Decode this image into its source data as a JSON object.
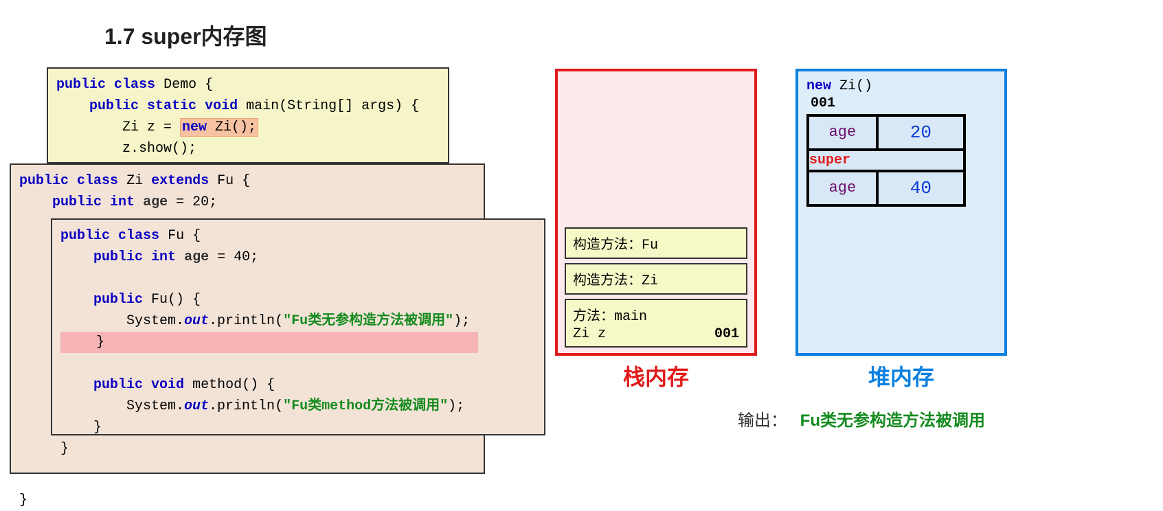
{
  "title": "1.7 super内存图",
  "code": {
    "demo": {
      "l1_kw1": "public",
      "l1_kw2": "class",
      "l1_name": "Demo {",
      "l2_kw1": "public",
      "l2_kw2": "static",
      "l2_kw3": "void",
      "l2_rest": "main(String[] args) {",
      "l3_a": "Zi z = ",
      "l3_new": "new ",
      "l3_b": "Zi();",
      "l4": "z.show();"
    },
    "zi": {
      "l1_kw1": "public",
      "l1_kw2": "class",
      "l1_name": "Zi",
      "l1_kw3": "extends",
      "l1_sup": "Fu {",
      "l2_kw1": "public",
      "l2_kw2": "int",
      "l2_f": "age",
      "l2_rest": " = 20;",
      "end": "}"
    },
    "fu": {
      "l1_kw1": "public",
      "l1_kw2": "class",
      "l1_name": "Fu {",
      "l2_kw1": "public",
      "l2_kw2": "int",
      "l2_f": "age",
      "l2_rest": " = 40;",
      "l3_kw": "public",
      "l3_rest": " Fu() {",
      "l4_a": "System.",
      "l4_out": "out",
      "l4_b": ".println(",
      "l4_str": "\"Fu类无参构造方法被调用\"",
      "l4_c": ");",
      "l5": "}",
      "l6_kw1": "public",
      "l6_kw2": "void",
      "l6_rest": " method() {",
      "l7_a": "System.",
      "l7_out": "out",
      "l7_b": ".println(",
      "l7_str": "\"Fu类method方法被调用\"",
      "l7_c": ");",
      "l8": "}",
      "end": "}"
    }
  },
  "stack": {
    "title": "栈内存",
    "frames": [
      {
        "line1": "构造方法：Fu"
      },
      {
        "line1": "构造方法：Zi"
      },
      {
        "line1": "方法：main",
        "line2a": "Zi z",
        "line2b": "001"
      }
    ]
  },
  "heap": {
    "title": "堆内存",
    "newcall_kw": "new",
    "newcall_rest": " Zi()",
    "addr": "001",
    "rows": [
      {
        "k": "age",
        "v": "20"
      },
      {
        "k": "age",
        "v": "40"
      }
    ],
    "super": "super"
  },
  "output": {
    "label": "输出：",
    "value": "Fu类无参构造方法被调用"
  }
}
